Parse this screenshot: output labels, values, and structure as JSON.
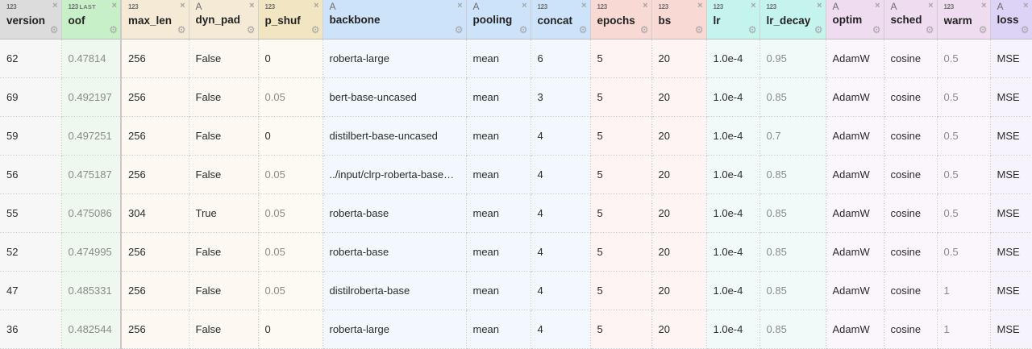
{
  "columns": [
    {
      "key": "version",
      "label": "version",
      "type": "123",
      "width": 76,
      "hbg": "#dcdcdc",
      "bg": "#f7f7f7"
    },
    {
      "key": "oof",
      "label": "oof",
      "type": "123",
      "width": 74,
      "hbg": "#c8f0c8",
      "bg": "#eef8ee",
      "badge": "LAST"
    },
    {
      "key": "max_len",
      "label": "max_len",
      "type": "123",
      "width": 84,
      "hbg": "#f5ead6",
      "bg": "#fdf9f2"
    },
    {
      "key": "dyn_pad",
      "label": "dyn_pad",
      "type": "A",
      "width": 86,
      "hbg": "#f5ead6",
      "bg": "#fdf9f2"
    },
    {
      "key": "p_shuf",
      "label": "p_shuf",
      "type": "123",
      "width": 80,
      "hbg": "#f2e6c2",
      "bg": "#fdfaf2"
    },
    {
      "key": "backbone",
      "label": "backbone",
      "type": "A",
      "width": 178,
      "hbg": "#cde3fa",
      "bg": "#f3f8fe"
    },
    {
      "key": "pooling",
      "label": "pooling",
      "type": "A",
      "width": 80,
      "hbg": "#cde3fa",
      "bg": "#f3f8fe"
    },
    {
      "key": "concat",
      "label": "concat",
      "type": "123",
      "width": 74,
      "hbg": "#cde3fa",
      "bg": "#f3f8fe"
    },
    {
      "key": "epochs",
      "label": "epochs",
      "type": "123",
      "width": 76,
      "hbg": "#f8d9d3",
      "bg": "#fdf4f3"
    },
    {
      "key": "bs",
      "label": "bs",
      "type": "123",
      "width": 68,
      "hbg": "#f8d9d3",
      "bg": "#fdf4f3"
    },
    {
      "key": "lr",
      "label": "lr",
      "type": "123",
      "width": 66,
      "hbg": "#c5f3ed",
      "bg": "#f0fbf9"
    },
    {
      "key": "lr_decay",
      "label": "lr_decay",
      "type": "123",
      "width": 82,
      "hbg": "#c5f3ed",
      "bg": "#f0fbf9"
    },
    {
      "key": "optim",
      "label": "optim",
      "type": "A",
      "width": 72,
      "hbg": "#f0dcf0",
      "bg": "#fbf6fb"
    },
    {
      "key": "sched",
      "label": "sched",
      "type": "A",
      "width": 66,
      "hbg": "#f0dcf0",
      "bg": "#fbf6fb"
    },
    {
      "key": "warm",
      "label": "warm",
      "type": "123",
      "width": 66,
      "hbg": "#f0dcf0",
      "bg": "#fbf6fb"
    },
    {
      "key": "loss",
      "label": "loss",
      "type": "A",
      "width": 52,
      "hbg": "#ddd3f7",
      "bg": "#f6f3fd"
    }
  ],
  "rows": [
    {
      "version": "62",
      "oof": "0.47814",
      "max_len": "256",
      "dyn_pad": "False",
      "p_shuf": "0",
      "backbone": "roberta-large",
      "pooling": "mean",
      "concat": "6",
      "epochs": "5",
      "bs": "20",
      "lr": "1.0e-4",
      "lr_decay": "0.95",
      "optim": "AdamW",
      "sched": "cosine",
      "warm": "0.5",
      "loss": "MSE"
    },
    {
      "version": "69",
      "oof": "0.492197",
      "max_len": "256",
      "dyn_pad": "False",
      "p_shuf": "0.05",
      "backbone": "bert-base-uncased",
      "pooling": "mean",
      "concat": "3",
      "epochs": "5",
      "bs": "20",
      "lr": "1.0e-4",
      "lr_decay": "0.85",
      "optim": "AdamW",
      "sched": "cosine",
      "warm": "0.5",
      "loss": "MSE"
    },
    {
      "version": "59",
      "oof": "0.497251",
      "max_len": "256",
      "dyn_pad": "False",
      "p_shuf": "0",
      "backbone": "distilbert-base-uncased",
      "pooling": "mean",
      "concat": "4",
      "epochs": "5",
      "bs": "20",
      "lr": "1.0e-4",
      "lr_decay": "0.7",
      "optim": "AdamW",
      "sched": "cosine",
      "warm": "0.5",
      "loss": "MSE"
    },
    {
      "version": "56",
      "oof": "0.475187",
      "max_len": "256",
      "dyn_pad": "False",
      "p_shuf": "0.05",
      "backbone": "../input/clrp-roberta-base…",
      "pooling": "mean",
      "concat": "4",
      "epochs": "5",
      "bs": "20",
      "lr": "1.0e-4",
      "lr_decay": "0.85",
      "optim": "AdamW",
      "sched": "cosine",
      "warm": "0.5",
      "loss": "MSE"
    },
    {
      "version": "55",
      "oof": "0.475086",
      "max_len": "304",
      "dyn_pad": "True",
      "p_shuf": "0.05",
      "backbone": "roberta-base",
      "pooling": "mean",
      "concat": "4",
      "epochs": "5",
      "bs": "20",
      "lr": "1.0e-4",
      "lr_decay": "0.85",
      "optim": "AdamW",
      "sched": "cosine",
      "warm": "0.5",
      "loss": "MSE"
    },
    {
      "version": "52",
      "oof": "0.474995",
      "max_len": "256",
      "dyn_pad": "False",
      "p_shuf": "0.05",
      "backbone": "roberta-base",
      "pooling": "mean",
      "concat": "4",
      "epochs": "5",
      "bs": "20",
      "lr": "1.0e-4",
      "lr_decay": "0.85",
      "optim": "AdamW",
      "sched": "cosine",
      "warm": "0.5",
      "loss": "MSE"
    },
    {
      "version": "47",
      "oof": "0.485331",
      "max_len": "256",
      "dyn_pad": "False",
      "p_shuf": "0.05",
      "backbone": "distilroberta-base",
      "pooling": "mean",
      "concat": "4",
      "epochs": "5",
      "bs": "20",
      "lr": "1.0e-4",
      "lr_decay": "0.85",
      "optim": "AdamW",
      "sched": "cosine",
      "warm": "1",
      "loss": "MSE"
    },
    {
      "version": "36",
      "oof": "0.482544",
      "max_len": "256",
      "dyn_pad": "False",
      "p_shuf": "0",
      "backbone": "roberta-large",
      "pooling": "mean",
      "concat": "4",
      "epochs": "5",
      "bs": "20",
      "lr": "1.0e-4",
      "lr_decay": "0.85",
      "optim": "AdamW",
      "sched": "cosine",
      "warm": "1",
      "loss": "MSE"
    }
  ],
  "icons": {
    "close": "×",
    "settings": "⚙"
  }
}
